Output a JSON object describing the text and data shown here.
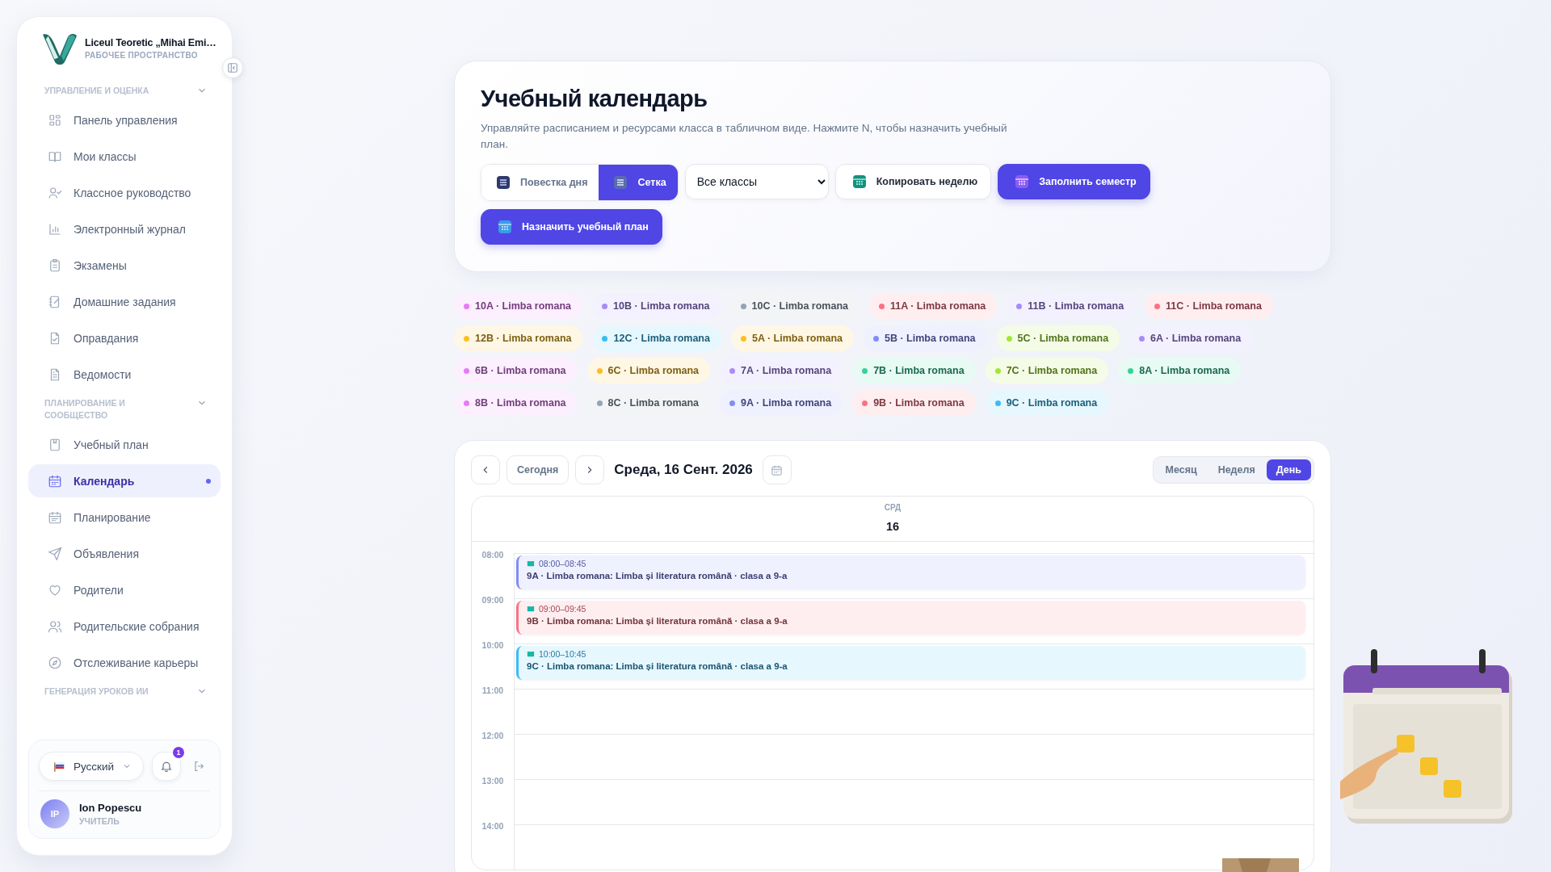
{
  "sidebar": {
    "brand": {
      "name": "Liceul Teoretic „Mihai Emi…",
      "subtitle": "РАБОЧЕЕ ПРОСТРАНСТВО"
    },
    "sections": [
      {
        "title": "УПРАВЛЕНИЕ И ОЦЕНКА",
        "items": [
          {
            "label": "Панель управления",
            "kind": "grid",
            "selected": false
          },
          {
            "label": "Мои классы",
            "kind": "book",
            "selected": false
          },
          {
            "label": "Классное руководство",
            "kind": "usercheck",
            "selected": false
          },
          {
            "label": "Электронный журнал",
            "kind": "chart",
            "selected": false
          },
          {
            "label": "Экзамены",
            "kind": "clipboard",
            "selected": false
          },
          {
            "label": "Домашние задания",
            "kind": "notebook",
            "selected": false
          },
          {
            "label": "Оправдания",
            "kind": "filecheck",
            "selected": false
          },
          {
            "label": "Ведомости",
            "kind": "filetext",
            "selected": false
          }
        ]
      },
      {
        "title": "ПЛАНИРОВАНИЕ И СООБЩЕСТВО",
        "items": [
          {
            "label": "Учебный план",
            "kind": "bookmark",
            "selected": false
          },
          {
            "label": "Календарь",
            "kind": "calendar",
            "selected": true
          },
          {
            "label": "Планирование",
            "kind": "calendarlines",
            "selected": false
          },
          {
            "label": "Объявления",
            "kind": "send",
            "selected": false
          },
          {
            "label": "Родители",
            "kind": "heart",
            "selected": false
          },
          {
            "label": "Родительские собрания",
            "kind": "users",
            "selected": false
          },
          {
            "label": "Отслеживание карьеры",
            "kind": "compass",
            "selected": false
          }
        ]
      },
      {
        "title": "ГЕНЕРАЦИЯ УРОКОВ ИИ"
      }
    ],
    "language": "Русский",
    "notification_count": "1",
    "user": {
      "initials": "IP",
      "name": "Ion Popescu",
      "role": "УЧИТЕЛЬ"
    }
  },
  "header": {
    "title": "Учебный календарь",
    "description": "Управляйте расписанием и ресурсами класса в табличном виде. Нажмите N, чтобы назначить учебный план.",
    "view_toggle": [
      {
        "label": "Повестка дня",
        "selected": false
      },
      {
        "label": "Сетка",
        "selected": true
      }
    ],
    "class_select": "Все классы",
    "buttons": [
      {
        "label": "Копировать неделю",
        "kind": "secondary"
      },
      {
        "label": "Заполнить семестр",
        "kind": "primary"
      },
      {
        "label": "Назначить учебный план",
        "kind": "primary"
      }
    ]
  },
  "chip_rows": [
    [
      {
        "label": "10A · Limba romana",
        "color": "#e879f9"
      },
      {
        "label": "10B · Limba romana",
        "color": "#a78bfa"
      },
      {
        "label": "10C · Limba romana",
        "color": "#94a3b8"
      },
      {
        "label": "11A · Limba romana",
        "color": "#fb7185"
      },
      {
        "label": "11B · Limba romana",
        "color": "#a78bfa"
      },
      {
        "label": "11C · Limba romana",
        "color": "#fb7185"
      }
    ],
    [
      {
        "label": "12B · Limba romana",
        "color": "#fbbf24"
      },
      {
        "label": "12C · Limba romana",
        "color": "#38bdf8"
      },
      {
        "label": "5A · Limba romana",
        "color": "#fbbf24"
      },
      {
        "label": "5B · Limba romana",
        "color": "#818cf8"
      },
      {
        "label": "5C · Limba romana",
        "color": "#a3e635"
      },
      {
        "label": "6A · Limba romana",
        "color": "#a78bfa"
      }
    ],
    [
      {
        "label": "6B · Limba romana",
        "color": "#e879f9"
      },
      {
        "label": "6C · Limba romana",
        "color": "#fbbf24"
      },
      {
        "label": "7A · Limba romana",
        "color": "#a78bfa"
      },
      {
        "label": "7B · Limba romana",
        "color": "#34d399"
      },
      {
        "label": "7C · Limba romana",
        "color": "#a3e635"
      },
      {
        "label": "8A · Limba romana",
        "color": "#34d399"
      }
    ],
    [
      {
        "label": "8B · Limba romana",
        "color": "#e879f9"
      },
      {
        "label": "8C · Limba romana",
        "color": "#94a3b8"
      },
      {
        "label": "9A · Limba romana",
        "color": "#818cf8"
      },
      {
        "label": "9B · Limba romana",
        "color": "#fb7185"
      },
      {
        "label": "9C · Limba romana",
        "color": "#38bdf8"
      }
    ]
  ],
  "calendar": {
    "today": "Сегодня",
    "date": "Среда, 16 Сент. 2026",
    "views": [
      {
        "label": "Месяц",
        "selected": false
      },
      {
        "label": "Неделя",
        "selected": false
      },
      {
        "label": "День",
        "selected": true
      }
    ],
    "weekday": "СРД",
    "day": "16",
    "hours": [
      {
        "label": "08:00",
        "events": [
          {
            "time": "08:00–08:45",
            "title": "9A · Limba romana: Limba și literatura română · clasa a 9-a",
            "color": "#818cf8"
          }
        ]
      },
      {
        "label": "09:00",
        "events": [
          {
            "time": "09:00–09:45",
            "title": "9B · Limba romana: Limba și literatura română · clasa a 9-a",
            "color": "#fb7185"
          }
        ]
      },
      {
        "label": "10:00",
        "events": [
          {
            "time": "10:00–10:45",
            "title": "9C · Limba romana: Limba și literatura română · clasa a 9-a",
            "color": "#38bdf8"
          }
        ]
      },
      {
        "label": "11:00"
      },
      {
        "label": "12:00"
      },
      {
        "label": "13:00"
      },
      {
        "label": "14:00"
      }
    ]
  }
}
